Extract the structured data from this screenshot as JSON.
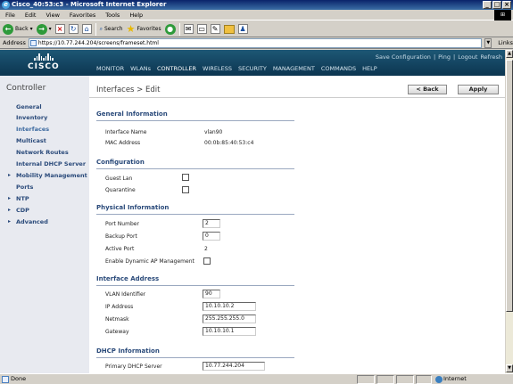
{
  "window": {
    "title": "Cisco_40:53:c3 - Microsoft Internet Explorer",
    "controls": [
      "_",
      "□",
      "×"
    ]
  },
  "menubar": {
    "items": [
      "File",
      "Edit",
      "View",
      "Favorites",
      "Tools",
      "Help"
    ]
  },
  "toolbar": {
    "back_label": "Back",
    "search_label": "Search",
    "favorites_label": "Favorites"
  },
  "address": {
    "label": "Address",
    "url": "https://10.77.244.204/screens/frameset.html",
    "links_label": "Links"
  },
  "header": {
    "logo_text": "CISCO",
    "top_links": [
      "Save Configuration",
      "Ping",
      "Logout",
      "Refresh"
    ],
    "nav_tabs": [
      "MONITOR",
      "WLANs",
      "CONTROLLER",
      "WIRELESS",
      "SECURITY",
      "MANAGEMENT",
      "COMMANDS",
      "HELP"
    ],
    "active_tab": "CONTROLLER"
  },
  "sidebar": {
    "title": "Controller",
    "items": [
      {
        "label": "General",
        "expandable": false
      },
      {
        "label": "Inventory",
        "expandable": false
      },
      {
        "label": "Interfaces",
        "expandable": false,
        "active": true
      },
      {
        "label": "Multicast",
        "expandable": false
      },
      {
        "label": "Network Routes",
        "expandable": false
      },
      {
        "label": "Internal DHCP Server",
        "expandable": false
      },
      {
        "label": "Mobility Management",
        "expandable": true
      },
      {
        "label": "Ports",
        "expandable": false
      },
      {
        "label": "NTP",
        "expandable": true
      },
      {
        "label": "CDP",
        "expandable": true
      },
      {
        "label": "Advanced",
        "expandable": true
      }
    ]
  },
  "page": {
    "title": "Interfaces > Edit",
    "back_button": "< Back",
    "apply_button": "Apply"
  },
  "general_info": {
    "heading": "General Information",
    "interface_name_label": "Interface Name",
    "interface_name_value": "vlan90",
    "mac_label": "MAC Address",
    "mac_value": "00:0b:85:40:53:c4"
  },
  "configuration": {
    "heading": "Configuration",
    "guest_lan_label": "Guest Lan",
    "guest_lan_checked": false,
    "quarantine_label": "Quarantine",
    "quarantine_checked": false
  },
  "physical_info": {
    "heading": "Physical Information",
    "port_number_label": "Port Number",
    "port_number_value": "2",
    "backup_port_label": "Backup Port",
    "backup_port_value": "0",
    "active_port_label": "Active Port",
    "active_port_value": "2",
    "dyn_ap_label": "Enable Dynamic AP Management",
    "dyn_ap_checked": false
  },
  "interface_address": {
    "heading": "Interface Address",
    "vlan_label": "VLAN Identifier",
    "vlan_value": "90",
    "ip_label": "IP Address",
    "ip_value": "10.10.10.2",
    "netmask_label": "Netmask",
    "netmask_value": "255.255.255.0",
    "gateway_label": "Gateway",
    "gateway_value": "10.10.10.1"
  },
  "dhcp_info": {
    "heading": "DHCP Information",
    "primary_label": "Primary DHCP Server",
    "primary_value": "10.77.244.204"
  },
  "statusbar": {
    "status": "Done",
    "zone": "Internet"
  }
}
